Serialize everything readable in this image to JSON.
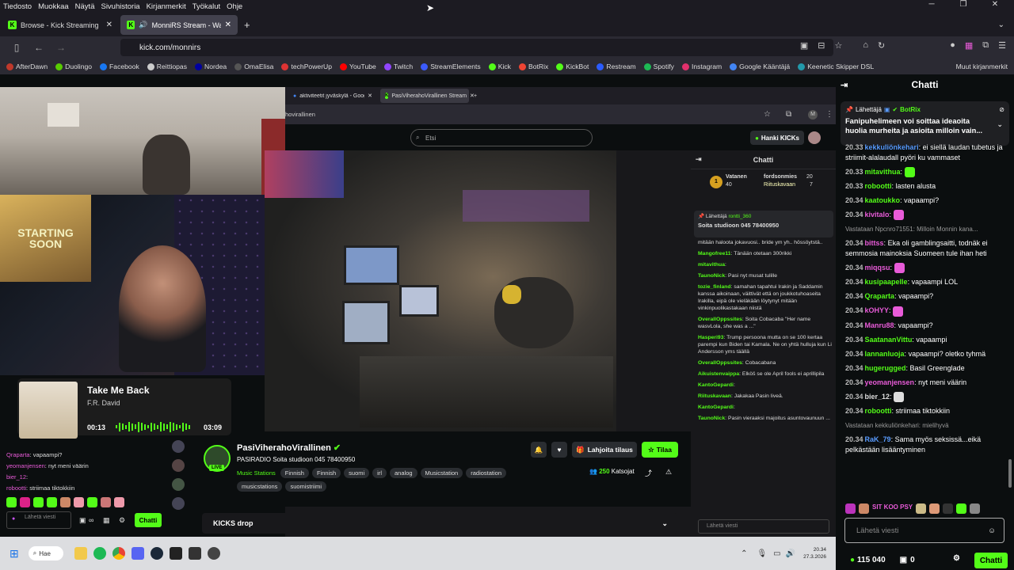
{
  "menubar": {
    "items": [
      "Tiedosto",
      "Muokkaa",
      "Näytä",
      "Sivuhistoria",
      "Kirjanmerkit",
      "Työkalut",
      "Ohje"
    ]
  },
  "tabs": [
    {
      "label": "Browse - Kick Streaming",
      "active": false
    },
    {
      "label": "MonniRS Stream - Watch L",
      "active": true
    }
  ],
  "address": {
    "url": "kick.com/monnirs"
  },
  "bookmarks": [
    {
      "label": "AfterDawn",
      "color": "#c0392b"
    },
    {
      "label": "Duolingo",
      "color": "#58cc02"
    },
    {
      "label": "Facebook",
      "color": "#1877f2"
    },
    {
      "label": "Reittiopas",
      "color": "#ccc"
    },
    {
      "label": "Nordea",
      "color": "#0000a0"
    },
    {
      "label": "OmaElisa",
      "color": "#555"
    },
    {
      "label": "techPowerUp",
      "color": "#d33"
    },
    {
      "label": "YouTube",
      "color": "#f00"
    },
    {
      "label": "Twitch",
      "color": "#9146ff"
    },
    {
      "label": "StreamElements",
      "color": "#3b5bfd"
    },
    {
      "label": "Kick",
      "color": "#53fc18"
    },
    {
      "label": "BotRix",
      "color": "#e43"
    },
    {
      "label": "KickBot",
      "color": "#53fc18"
    },
    {
      "label": "Restream",
      "color": "#2b5cff"
    },
    {
      "label": "Spotify",
      "color": "#1db954"
    },
    {
      "label": "Instagram",
      "color": "#e1306c"
    },
    {
      "label": "Google Kääntäjä",
      "color": "#4285f4"
    },
    {
      "label": "Keenetic Skipper DSL",
      "color": "#29a"
    }
  ],
  "bookmarks_other": "Muut kirjanmerkit",
  "inner": {
    "tabs": [
      "aktiviteetit jyväskylä - Google H",
      "PasiViherahoVirallinen Stream"
    ],
    "url": "hovirallinen",
    "search_placeholder": "Etsi",
    "hanki": "Hanki KICKs",
    "chat_title": "Chatti",
    "leaders": [
      {
        "rank": "1",
        "name": "Vatanen",
        "count": "40"
      },
      {
        "name": "fordsonmies",
        "count": "20"
      },
      {
        "name": "Riituskavaan",
        "count": "7"
      }
    ],
    "pinned_sender": "Lähettäjä",
    "pinned_user": "rontti_360",
    "pinned_text": "Soita studioon 045 78400950",
    "chat_lines": [
      {
        "user": "",
        "text": "mitään haloota jokavuosi.. bride ym yh.. hössöytstä.."
      },
      {
        "user": "Mangofree11",
        "text": "Tänään otetaan 300rikki"
      },
      {
        "user": "mitavithua",
        "text": ""
      },
      {
        "user": "TaunoNick",
        "text": "Pasi nyt musat tulille"
      },
      {
        "user": "tozie_finland",
        "text": "samahan tapahtui Irakin ja Saddamin kanssa aikoinaan, väittivät että on joukkotuhoaseita Irakilla, eipä ole vieläkään löytynyt mitään vinkinpuolikastakaan niistä"
      },
      {
        "user": "OverallOppssites",
        "text": "Soita Cobacaba \"Her name wasvLola, she was a ...\""
      },
      {
        "user": "Hasperi93",
        "text": "Trump persoona mutta on se 100 kertaa parempi kun Biden tai Kamala. Ne on yhtä hulluja kun Li Andersson yms täällä"
      },
      {
        "user": "OverallOppssites",
        "text": "Cobacabana"
      },
      {
        "user": "Aikuistenvaippa",
        "text": "Elköš se ole April fools ei aprillipila"
      },
      {
        "user": "KantoGepardi",
        "text": ""
      },
      {
        "user": "Riituskavaan",
        "text": "Jakakaa Pasin liveä."
      },
      {
        "user": "KantoGepardi",
        "text": ""
      },
      {
        "user": "TaunoNick",
        "text": "Pasin vieraaksi majoitus asuntovaunuun ..."
      }
    ],
    "send_placeholder": "Lähetä viesti",
    "streamer": "PasiViherahoVirallinen",
    "stream_title": "PASIRADIO Soita studioon 045 78400950",
    "category": "Music Stations",
    "tags": [
      "Finnish",
      "Finnish",
      "suomi",
      "irl",
      "analog",
      "Musicstation",
      "radiostation",
      "musicstations",
      "suomistriimi"
    ],
    "gift_label": "Lahjoita tilaus",
    "sub_label": "Tilaa",
    "viewers": "250",
    "viewers_label": "Katsojat",
    "kicks_drop": "KICKS drop",
    "live": "LIVE",
    "chat_btn": "Chatti"
  },
  "overlay": {
    "starting": "STARTING SOON",
    "song_title": "Take Me Back",
    "song_artist": "F.R. David",
    "time_elapsed": "00:13",
    "time_total": "03:09",
    "left_chat": [
      {
        "user": "Qraparta",
        "text": "vapaampi?"
      },
      {
        "user": "yeomanjensen",
        "text": "nyt meni väärin"
      },
      {
        "user": "bier_12",
        "text": ""
      },
      {
        "user": "robootti",
        "text": "striimaa tiktokkiin"
      }
    ],
    "send_placeholder": "Lähetä viesti",
    "chat_btn": "Chatti"
  },
  "chat": {
    "title": "Chatti",
    "pinned_sender": "Lähettäjä",
    "pinned_user": "BotRix",
    "pinned_text": "Fanipuhelimeen voi soittaa ideaoita huolia murheita ja asioita milloin vain...",
    "messages": [
      {
        "time": "20.33",
        "user": "kekkuliönkehari",
        "color": "#5a9cff",
        "text": "ei siellä laudan tubetus ja striimit-alalaudall pyöri ku vammaset"
      },
      {
        "time": "20.33",
        "user": "mitavithua",
        "color": "#53fc18",
        "text": ""
      },
      {
        "time": "20.33",
        "user": "robootti",
        "color": "#53fc18",
        "text": "lasten alusta"
      },
      {
        "time": "20.34",
        "user": "kaatoukko",
        "color": "#53fc18",
        "text": "vapaampi?"
      },
      {
        "time": "20.34",
        "user": "kivitalo",
        "color": "#e85bd8",
        "text": ""
      },
      {
        "time": "",
        "user": "",
        "color": "#999",
        "text": "Vastataan Npcnro71551: Milloin Monnin kana..."
      },
      {
        "time": "20.34",
        "user": "bittss",
        "color": "#e85bd8",
        "text": "Eka oli gamblingsaitti, todnäk ei semmosia mainoksia Suomeen tule ihan heti"
      },
      {
        "time": "20.34",
        "user": "miqqsu",
        "color": "#e85bd8",
        "text": ""
      },
      {
        "time": "20.34",
        "user": "kusipaapelle",
        "color": "#53fc18",
        "text": "vapaampi LOL"
      },
      {
        "time": "20.34",
        "user": "Qraparta",
        "color": "#53fc18",
        "text": "vapaampi?"
      },
      {
        "time": "20.34",
        "user": "kOHYY",
        "color": "#e85bd8",
        "text": ""
      },
      {
        "time": "20.34",
        "user": "Manru88",
        "color": "#e85bd8",
        "text": "vapaampi?"
      },
      {
        "time": "20.34",
        "user": "SaatananVittu",
        "color": "#53fc18",
        "text": "vapaampi"
      },
      {
        "time": "20.34",
        "user": "lannanluoja",
        "color": "#53fc18",
        "text": "vapaampi? oletko tyhmä"
      },
      {
        "time": "20.34",
        "user": "hugerugged",
        "color": "#53fc18",
        "text": "Basil Greenglade"
      },
      {
        "time": "20.34",
        "user": "yeomanjensen",
        "color": "#e85bd8",
        "text": "nyt meni väärin"
      },
      {
        "time": "20.34",
        "user": "bier_12",
        "color": "#ddd",
        "text": ""
      },
      {
        "time": "20.34",
        "user": "robootti",
        "color": "#53fc18",
        "text": "striimaa tiktokkiin"
      },
      {
        "time": "",
        "user": "",
        "color": "#999",
        "text": "Vastataan kekkuliönkehari: mielihyvä"
      },
      {
        "time": "20.34",
        "user": "RaK_79",
        "color": "#5a9cff",
        "text": "Sama myös seksissä...eikä pelkästään lisääntyminen"
      }
    ],
    "emote_text": "SIT KOO PSY",
    "input_placeholder": "Lähetä viesti",
    "kicks_count": "115 040",
    "kicks_zero": "0",
    "send_button": "Chatti"
  },
  "taskbar": {
    "search": "Hae",
    "clock_time": "20.34",
    "clock_date": "27.3.2026"
  }
}
